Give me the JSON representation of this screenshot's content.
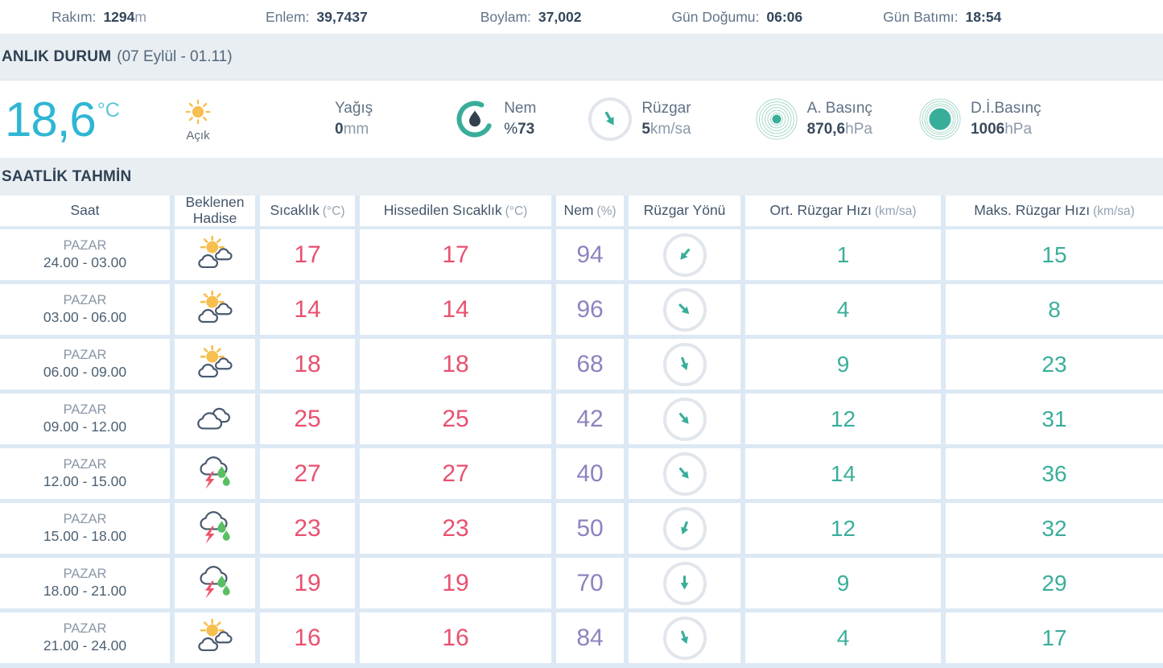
{
  "topbar": {
    "items": [
      {
        "label": "Rakım:",
        "value": "1294",
        "unit": "m"
      },
      {
        "label": "Enlem:",
        "value": "39,7437",
        "unit": ""
      },
      {
        "label": "Boylam:",
        "value": "37,002",
        "unit": ""
      },
      {
        "label": "Gün Doğumu:",
        "value": "06:06",
        "unit": ""
      },
      {
        "label": "Gün Batımı:",
        "value": "18:54",
        "unit": ""
      }
    ]
  },
  "current": {
    "title": "ANLIK DURUM",
    "period": "(07 Eylül - 01.11)",
    "temperature": "18,6",
    "temperature_unit": "°C",
    "condition": "Açık",
    "condition_icon": "sun-icon",
    "precipitation": {
      "label": "Yağış",
      "value": "0",
      "unit": "mm"
    },
    "humidity": {
      "label": "Nem",
      "prefix": "%",
      "value": "73",
      "icon": "humidity-gauge-icon"
    },
    "wind": {
      "label": "Rüzgar",
      "value": "5",
      "unit": "km/sa",
      "arrow_deg": 150,
      "icon": "wind-direction-icon"
    },
    "actual_pressure": {
      "label": "A. Basınç",
      "value": "870,6",
      "unit": "hPa",
      "icon": "pressure-rings-icon"
    },
    "sea_level_pressure": {
      "label": "D.İ.Basınç",
      "value": "1006",
      "unit": "hPa",
      "icon": "pressure-filled-icon"
    }
  },
  "forecast": {
    "title": "SAATLİK TAHMİN",
    "columns": [
      {
        "label": "Saat",
        "unit": ""
      },
      {
        "label": "Beklenen Hadise",
        "unit": ""
      },
      {
        "label": "Sıcaklık",
        "unit": "(°C)"
      },
      {
        "label": "Hissedilen Sıcaklık",
        "unit": "(°C)"
      },
      {
        "label": "Nem",
        "unit": "(%)"
      },
      {
        "label": "Rüzgar Yönü",
        "unit": ""
      },
      {
        "label": "Ort. Rüzgar Hızı",
        "unit": "(km/sa)"
      },
      {
        "label": "Maks. Rüzgar Hızı",
        "unit": "(km/sa)"
      }
    ],
    "rows": [
      {
        "day": "PAZAR",
        "hours": "24.00 - 03.00",
        "icon": "sun-cloud",
        "temp": "17",
        "feels": "17",
        "humidity": "94",
        "wind_deg": 220,
        "avg": "1",
        "max": "15"
      },
      {
        "day": "PAZAR",
        "hours": "03.00 - 06.00",
        "icon": "sun-cloud",
        "temp": "14",
        "feels": "14",
        "humidity": "96",
        "wind_deg": 135,
        "avg": "4",
        "max": "8"
      },
      {
        "day": "PAZAR",
        "hours": "06.00 - 09.00",
        "icon": "sun-cloud",
        "temp": "18",
        "feels": "18",
        "humidity": "68",
        "wind_deg": 160,
        "avg": "9",
        "max": "23"
      },
      {
        "day": "PAZAR",
        "hours": "09.00 - 12.00",
        "icon": "clouds",
        "temp": "25",
        "feels": "25",
        "humidity": "42",
        "wind_deg": 140,
        "avg": "12",
        "max": "31"
      },
      {
        "day": "PAZAR",
        "hours": "12.00 - 15.00",
        "icon": "storm",
        "temp": "27",
        "feels": "27",
        "humidity": "40",
        "wind_deg": 140,
        "avg": "14",
        "max": "36"
      },
      {
        "day": "PAZAR",
        "hours": "15.00 - 18.00",
        "icon": "storm",
        "temp": "23",
        "feels": "23",
        "humidity": "50",
        "wind_deg": 200,
        "avg": "12",
        "max": "32"
      },
      {
        "day": "PAZAR",
        "hours": "18.00 - 21.00",
        "icon": "storm",
        "temp": "19",
        "feels": "19",
        "humidity": "70",
        "wind_deg": 180,
        "avg": "9",
        "max": "29"
      },
      {
        "day": "PAZAR",
        "hours": "21.00 - 24.00",
        "icon": "sun-cloud",
        "temp": "16",
        "feels": "16",
        "humidity": "84",
        "wind_deg": 160,
        "avg": "4",
        "max": "17"
      }
    ]
  },
  "colors": {
    "accent_teal": "#38ae9a",
    "temp_cyan": "#2eb6d4",
    "temp_pink": "#e8516f",
    "humidity_purple": "#8b84c0",
    "sun_yellow": "#f6bf4f",
    "lightning_red": "#ee5368",
    "rain_green": "#5abf63",
    "header_bg": "#e9eef2",
    "table_gap_bg": "#dce9f4"
  }
}
